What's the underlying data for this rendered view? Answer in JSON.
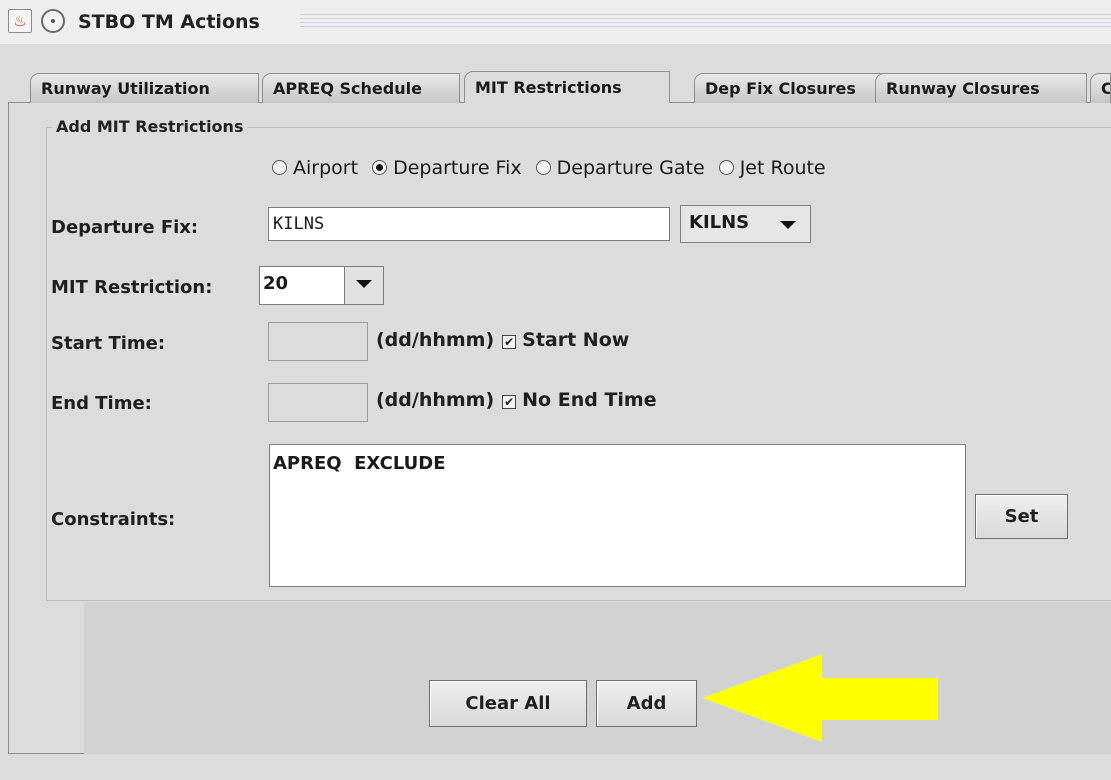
{
  "window": {
    "title": "STBO TM Actions"
  },
  "tabs": [
    {
      "label": "Runway Utilization"
    },
    {
      "label": "APREQ Schedule"
    },
    {
      "label": "MIT Restrictions",
      "selected": true
    },
    {
      "label": "Dep Fix Closures"
    },
    {
      "label": "Runway Closures"
    },
    {
      "label": "C"
    }
  ],
  "form": {
    "group_title": "Add MIT Restrictions",
    "radio_options": [
      {
        "label": "Airport",
        "selected": false
      },
      {
        "label": "Departure Fix",
        "selected": true
      },
      {
        "label": "Departure Gate",
        "selected": false
      },
      {
        "label": "Jet Route",
        "selected": false
      }
    ],
    "departure_fix_label": "Departure Fix:",
    "departure_fix_value": "KILNS",
    "departure_fix_select": "KILNS",
    "mit_label": "MIT Restriction:",
    "mit_value": "20",
    "start_time_label": "Start Time:",
    "start_time_value": "",
    "start_time_format": "(dd/hhmm)",
    "start_now_label": "Start Now",
    "start_now_checked": true,
    "end_time_label": "End Time:",
    "end_time_value": "",
    "end_time_format": "(dd/hhmm)",
    "no_end_label": "No End Time",
    "no_end_checked": true,
    "constraints_label": "Constraints:",
    "constraints_value": "APREQ  EXCLUDE",
    "set_button": "Set"
  },
  "actions": {
    "clear_all": "Clear All",
    "add": "Add"
  },
  "colors": {
    "highlight_arrow": "#ffff00"
  },
  "icons": {
    "app": "java-app-icon",
    "window_menu": "circle-icon",
    "check": "✔"
  }
}
